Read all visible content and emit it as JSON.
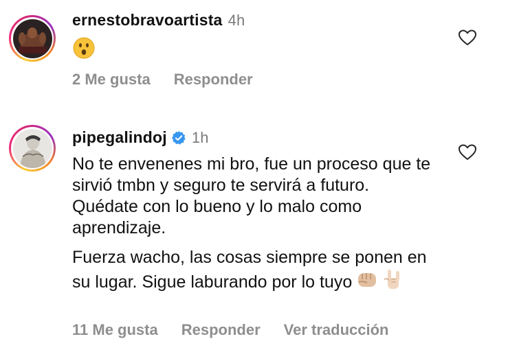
{
  "comments": [
    {
      "username": "ernestobravoartista",
      "time": "4h",
      "verified": false,
      "content_emoji": "astonished-face",
      "likes_label": "2 Me gusta",
      "reply_label": "Responder"
    },
    {
      "username": "pipegalindoj",
      "time": "1h",
      "verified": true,
      "paragraph_1": "No te envenenes mi bro, fue un proceso que te sirvió tmbn y seguro te servirá a futuro. Quédate con lo bueno y lo malo como aprendizaje.",
      "paragraph_2": "Fuerza wacho, las cosas siempre se ponen en su lugar. Sigue laburando por lo tuyo",
      "paragraph_2_emojis": [
        "oncoming-fist",
        "sign-of-the-horns"
      ],
      "likes_label": "11 Me gusta",
      "reply_label": "Responder",
      "translate_label": "Ver traducción"
    }
  ],
  "colors": {
    "text": "#111111",
    "muted": "#8e8e8e",
    "verified_blue": "#3897f0",
    "story_ring": [
      "#f9ce34",
      "#ee2a7b",
      "#962fbf"
    ]
  }
}
